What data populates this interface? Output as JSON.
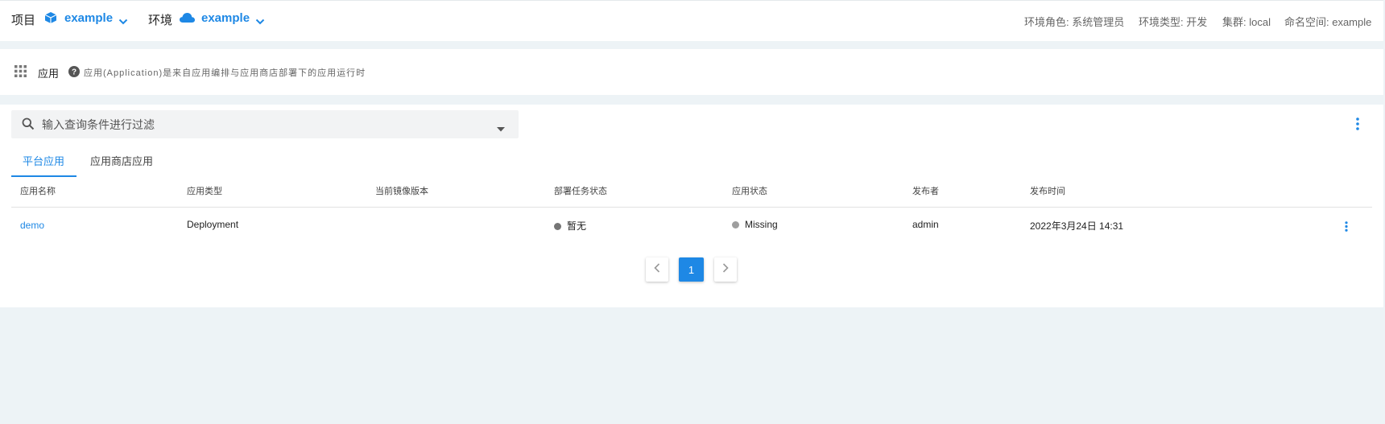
{
  "topbar": {
    "project_label": "项目",
    "project_value": "example",
    "env_label": "环境",
    "env_value": "example",
    "meta": {
      "env_role": "环境角色: 系统管理员",
      "env_type": "环境类型: 开发",
      "cluster": "集群: local",
      "namespace": "命名空间: example"
    }
  },
  "header": {
    "title": "应用",
    "help_text": "应用(Application)是来自应用编排与应用商店部署下的应用运行时"
  },
  "filter": {
    "placeholder": "输入查询条件进行过滤"
  },
  "tabs": [
    {
      "label": "平台应用",
      "active": true
    },
    {
      "label": "应用商店应用",
      "active": false
    }
  ],
  "table": {
    "columns": [
      "应用名称",
      "应用类型",
      "当前镜像版本",
      "部署任务状态",
      "应用状态",
      "发布者",
      "发布时间"
    ],
    "rows": [
      {
        "name": "demo",
        "type": "Deployment",
        "image_version": "",
        "deploy_status": "暂无",
        "app_status": "Missing",
        "publisher": "admin",
        "publish_time": "2022年3月24日 14:31"
      }
    ]
  },
  "pagination": {
    "current_page": "1"
  },
  "colors": {
    "accent": "#1e88e5",
    "background": "#edf3f6"
  },
  "icons": [
    "cube-icon",
    "cloud-icon",
    "chevron-down-icon",
    "apps-grid-icon",
    "help-icon",
    "search-icon",
    "dropdown-arrow-icon",
    "more-vert-icon",
    "chevron-left-icon",
    "chevron-right-icon"
  ]
}
